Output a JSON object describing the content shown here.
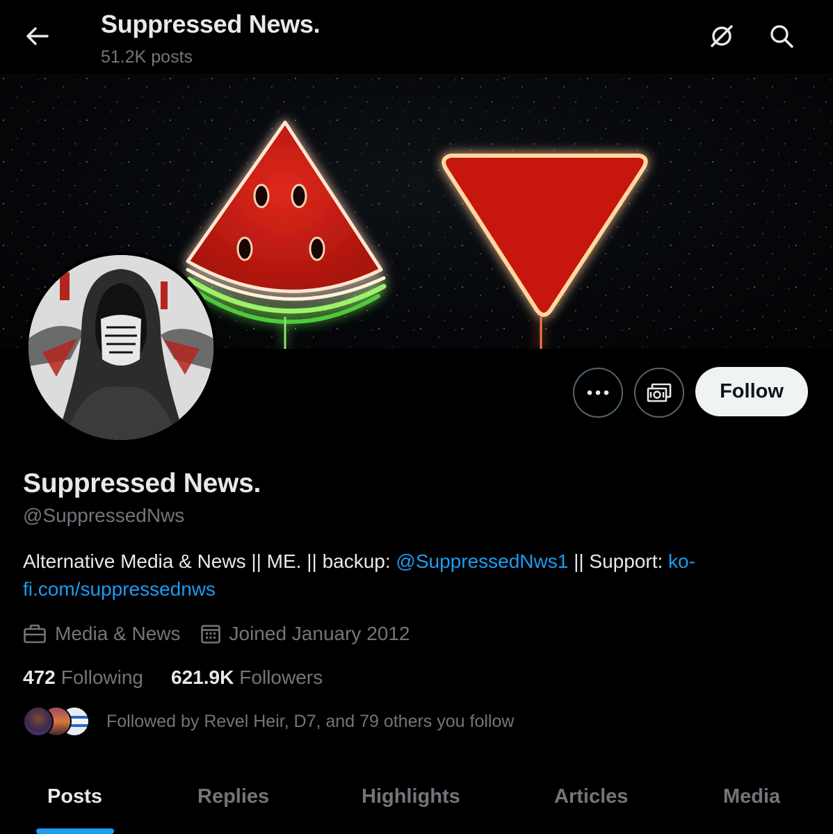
{
  "header": {
    "title": "Suppressed News.",
    "posts_count": "51.2K posts"
  },
  "profile": {
    "name": "Suppressed News.",
    "handle": "@SuppressedNws",
    "bio": {
      "text_1": "Alternative Media & News || ME. || backup: ",
      "link_1": "@SuppressedNws1",
      "text_2": " || Support: ",
      "link_2": "ko-fi.com/suppressednws"
    },
    "category": "Media & News",
    "joined": "Joined January 2012",
    "following_count": "472",
    "following_label": "Following",
    "followers_count": "621.9K",
    "followers_label": "Followers",
    "followed_by": "Followed by Revel Heir, D7, and 79 others you follow"
  },
  "actions": {
    "follow_label": "Follow"
  },
  "tabs": [
    {
      "label": "Posts",
      "active": true
    },
    {
      "label": "Replies",
      "active": false
    },
    {
      "label": "Highlights",
      "active": false
    },
    {
      "label": "Articles",
      "active": false
    },
    {
      "label": "Media",
      "active": false
    }
  ],
  "icons": {
    "back": "arrow-left-icon",
    "grok": "grok-icon",
    "search": "search-icon",
    "more": "more-icon",
    "subscribe": "subscribe-icon",
    "category": "briefcase-icon",
    "joined": "calendar-icon"
  },
  "colors": {
    "accent": "#1d9bf0",
    "text": "#e7e9ea",
    "muted": "#71767b",
    "background": "#000000"
  }
}
